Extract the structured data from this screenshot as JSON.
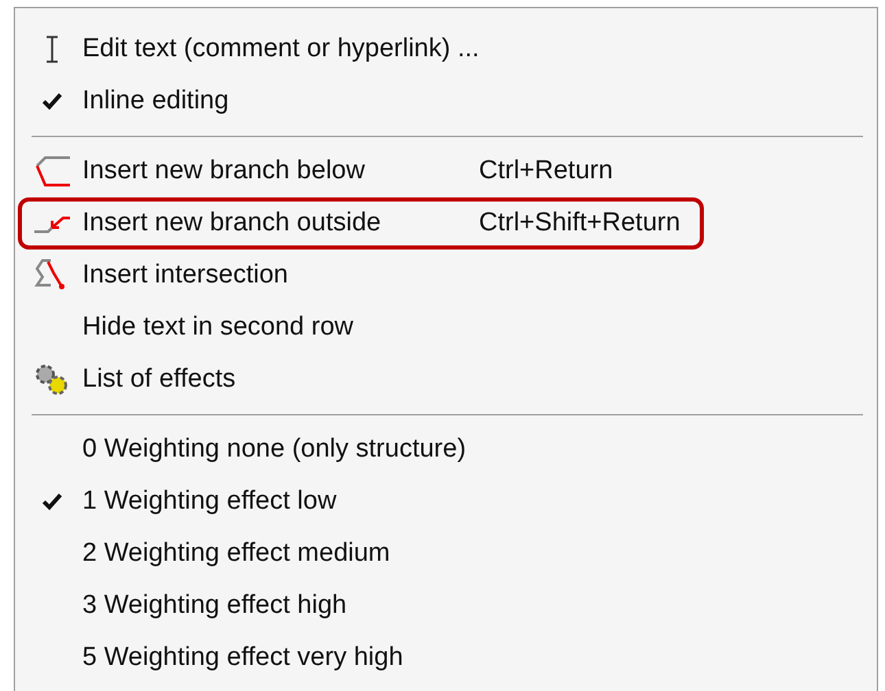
{
  "menu": {
    "sections": [
      {
        "items": [
          {
            "kind": "cursor",
            "label": "Edit text (comment or hyperlink) ...",
            "highlighted": false
          },
          {
            "kind": "toggle",
            "checked": true,
            "label": "Inline editing",
            "highlighted": false
          }
        ]
      },
      {
        "items": [
          {
            "kind": "below",
            "label": "Insert new branch below",
            "shortcut": "Ctrl+Return",
            "highlighted": false
          },
          {
            "kind": "outside",
            "label": "Insert new branch outside",
            "shortcut": "Ctrl+Shift+Return",
            "highlighted": true
          },
          {
            "kind": "intersection",
            "label": "Insert intersection",
            "highlighted": false
          },
          {
            "kind": "plain",
            "label": "Hide text in second row",
            "highlighted": false
          },
          {
            "kind": "effects",
            "label": "List of effects",
            "highlighted": false
          }
        ]
      },
      {
        "items": [
          {
            "kind": "toggle",
            "checked": false,
            "label": "0 Weighting none (only structure)",
            "highlighted": false
          },
          {
            "kind": "toggle",
            "checked": true,
            "label": "1 Weighting effect low",
            "highlighted": false
          },
          {
            "kind": "toggle",
            "checked": false,
            "label": "2 Weighting effect medium",
            "highlighted": false
          },
          {
            "kind": "toggle",
            "checked": false,
            "label": "3 Weighting effect high",
            "highlighted": false
          },
          {
            "kind": "toggle",
            "checked": false,
            "label": "5 Weighting effect very high",
            "highlighted": false
          }
        ]
      }
    ]
  }
}
